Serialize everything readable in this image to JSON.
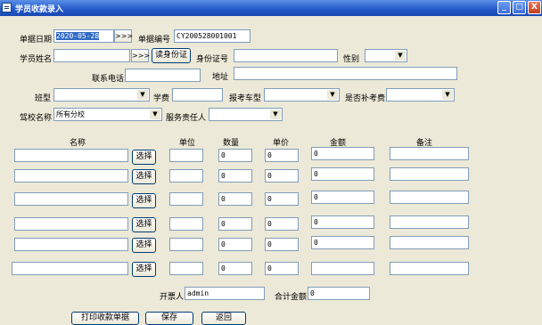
{
  "window": {
    "title": "学员收款录入",
    "min": "_",
    "max": "□",
    "close": "X"
  },
  "row1": {
    "date_label": "单据日期",
    "date_value": "2020-05-28",
    "date_btn": ">>>",
    "no_label": "单据编号",
    "no_value": "CY200528001001"
  },
  "row2": {
    "name_label": "学员姓名",
    "name_value": "",
    "pick_btn": ">>>",
    "read_id_btn": "读身份证",
    "id_label": "身份证号",
    "id_value": "",
    "gender_label": "性别",
    "gender_value": ""
  },
  "row3": {
    "phone_label": "联系电话",
    "phone_value": "",
    "addr_label": "地址",
    "addr_value": ""
  },
  "row4": {
    "class_label": "班型",
    "class_value": "",
    "fee_label": "学费",
    "fee_value": "",
    "car_label": "报考车型",
    "car_value": "",
    "retake_label": "是否补考费",
    "retake_value": ""
  },
  "row5": {
    "school_label": "驾校名称",
    "school_value": "所有分校",
    "staff_label": "服务责任人",
    "staff_value": ""
  },
  "table": {
    "headers": [
      "名称",
      "单位",
      "数量",
      "单价",
      "金额",
      "备注"
    ],
    "select_label": "选择",
    "rows": [
      {
        "name": "",
        "unit": "",
        "qty": "0",
        "price": "0",
        "amount": "0",
        "note": ""
      },
      {
        "name": "",
        "unit": "",
        "qty": "0",
        "price": "0",
        "amount": "0",
        "note": ""
      },
      {
        "name": "",
        "unit": "",
        "qty": "0",
        "price": "0",
        "amount": "0",
        "note": ""
      },
      {
        "name": "",
        "unit": "",
        "qty": "0",
        "price": "0",
        "amount": "0",
        "note": ""
      },
      {
        "name": "",
        "unit": "",
        "qty": "0",
        "price": "0",
        "amount": "0",
        "note": ""
      },
      {
        "name": "",
        "unit": "",
        "qty": "0",
        "price": "0",
        "amount": "",
        "note": ""
      }
    ]
  },
  "footer": {
    "issuer_label": "开票人",
    "issuer_value": "admin",
    "total_label": "合计金额",
    "total_value": "0"
  },
  "actions": {
    "print": "打印收款单据",
    "save": "保存",
    "back": "返回"
  }
}
